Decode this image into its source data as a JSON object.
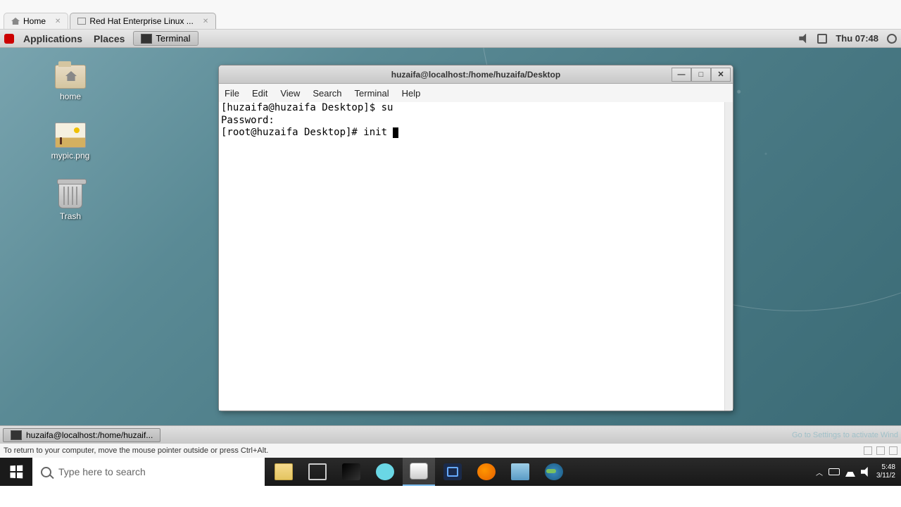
{
  "vm_tabs": {
    "home_label": "Home",
    "vm_label": "Red Hat Enterprise Linux ..."
  },
  "gnome": {
    "menu": {
      "applications": "Applications",
      "places": "Places"
    },
    "task_terminal": "Terminal",
    "clock": "Thu 07:48",
    "desktop_icons": {
      "home": "home",
      "pic": "mypic.png",
      "trash": "Trash"
    },
    "bottom_task": "huzaifa@localhost:/home/huzaif...",
    "activate": "Go to Settings to activate Wind"
  },
  "terminal": {
    "title": "huzaifa@localhost:/home/huzaifa/Desktop",
    "menus": {
      "file": "File",
      "edit": "Edit",
      "view": "View",
      "search": "Search",
      "terminal": "Terminal",
      "help": "Help"
    },
    "lines": {
      "l1_prompt": "[huzaifa@huzaifa Desktop]$ ",
      "l1_cmd": "su",
      "l2": "Password:",
      "l3_prompt": "[root@huzaifa Desktop]# ",
      "l3_cmd": "init "
    }
  },
  "vmware_hint": "To return to your computer, move the mouse pointer outside or press Ctrl+Alt.",
  "windows": {
    "search_placeholder": "Type here to search",
    "tray": {
      "time": "5:48",
      "date": "3/11/2"
    }
  }
}
